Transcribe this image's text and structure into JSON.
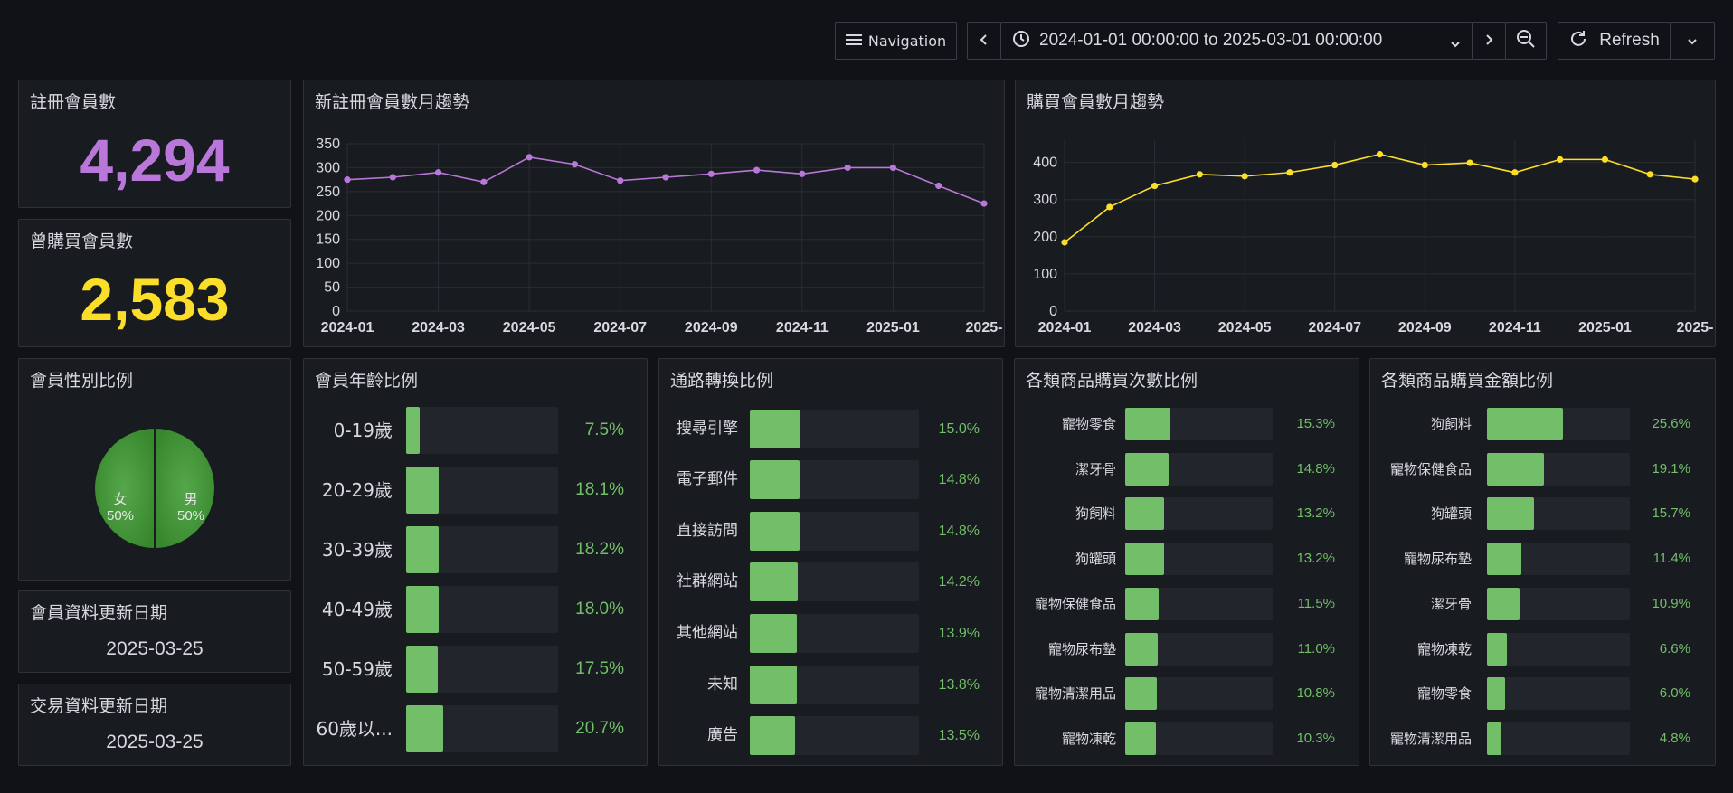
{
  "toolbar": {
    "navigation_label": "Navigation",
    "time_range": "2024-01-01 00:00:00 to 2025-03-01 00:00:00",
    "refresh_label": "Refresh"
  },
  "stats": {
    "registered_title": "註冊會員數",
    "registered_value": "4,294",
    "purchased_title": "曾購買會員數",
    "purchased_value": "2,583",
    "gender_title": "會員性別比例",
    "member_update_title": "會員資料更新日期",
    "member_update_value": "2025-03-25",
    "trade_update_title": "交易資料更新日期",
    "trade_update_value": "2025-03-25"
  },
  "gender": [
    {
      "label": "女",
      "pct": "50%",
      "value": 0.5
    },
    {
      "label": "男",
      "pct": "50%",
      "value": 0.5
    }
  ],
  "colors": {
    "purple": "#b877d9",
    "yellow": "#fade2a",
    "green": "#73bf69",
    "pie_green": "#37872d"
  },
  "chart_data": [
    {
      "type": "line",
      "title": "新註冊會員數月趨勢",
      "x": [
        "2024-01",
        "2024-02",
        "2024-03",
        "2024-04",
        "2024-05",
        "2024-06",
        "2024-07",
        "2024-08",
        "2024-09",
        "2024-10",
        "2024-11",
        "2024-12",
        "2025-01",
        "2025-02",
        "2025-03"
      ],
      "series": [
        {
          "values": [
            275,
            280,
            290,
            270,
            322,
            307,
            273,
            280,
            287,
            295,
            287,
            300,
            300,
            262,
            225
          ]
        }
      ],
      "xticks": [
        "2024-01",
        "2024-03",
        "2024-05",
        "2024-07",
        "2024-09",
        "2024-11",
        "2025-01",
        "2025-"
      ],
      "yticks": [
        0,
        50,
        100,
        150,
        200,
        250,
        300,
        350
      ],
      "ylim": [
        0,
        350
      ],
      "color": "#b877d9",
      "grid": true
    },
    {
      "type": "line",
      "title": "購買會員數月趨勢",
      "x": [
        "2024-01",
        "2024-02",
        "2024-03",
        "2024-04",
        "2024-05",
        "2024-06",
        "2024-07",
        "2024-08",
        "2024-09",
        "2024-10",
        "2024-11",
        "2024-12",
        "2025-01",
        "2025-02",
        "2025-03"
      ],
      "series": [
        {
          "values": [
            185,
            280,
            337,
            368,
            363,
            373,
            393,
            422,
            393,
            399,
            373,
            408,
            408,
            368,
            355
          ]
        }
      ],
      "xticks": [
        "2024-01",
        "2024-03",
        "2024-05",
        "2024-07",
        "2024-09",
        "2024-11",
        "2025-01",
        "2025-"
      ],
      "yticks": [
        0,
        100,
        200,
        300,
        400
      ],
      "ylim": [
        0,
        460
      ],
      "color": "#fade2a",
      "grid": true
    },
    {
      "type": "bar",
      "title": "會員年齡比例",
      "categories": [
        "0-19歲",
        "20-29歲",
        "30-39歲",
        "40-49歲",
        "50-59歲",
        "60歲以..."
      ],
      "values": [
        7.5,
        18.1,
        18.2,
        18.0,
        17.5,
        20.7
      ],
      "labels": [
        "7.5%",
        "18.1%",
        "18.2%",
        "18.0%",
        "17.5%",
        "20.7%"
      ]
    },
    {
      "type": "bar",
      "title": "通路轉換比例",
      "categories": [
        "搜尋引擎",
        "電子郵件",
        "直接訪問",
        "社群網站",
        "其他網站",
        "未知",
        "廣告"
      ],
      "values": [
        15.0,
        14.8,
        14.8,
        14.2,
        13.9,
        13.8,
        13.5
      ],
      "labels": [
        "15.0%",
        "14.8%",
        "14.8%",
        "14.2%",
        "13.9%",
        "13.8%",
        "13.5%"
      ]
    },
    {
      "type": "bar",
      "title": "各類商品購買次數比例",
      "categories": [
        "寵物零食",
        "潔牙骨",
        "狗飼料",
        "狗罐頭",
        "寵物保健食品",
        "寵物尿布墊",
        "寵物清潔用品",
        "寵物凍乾"
      ],
      "values": [
        15.3,
        14.8,
        13.2,
        13.2,
        11.5,
        11.0,
        10.8,
        10.3
      ],
      "labels": [
        "15.3%",
        "14.8%",
        "13.2%",
        "13.2%",
        "11.5%",
        "11.0%",
        "10.8%",
        "10.3%"
      ]
    },
    {
      "type": "bar",
      "title": "各類商品購買金額比例",
      "categories": [
        "狗飼料",
        "寵物保健食品",
        "狗罐頭",
        "寵物尿布墊",
        "潔牙骨",
        "寵物凍乾",
        "寵物零食",
        "寵物清潔用品"
      ],
      "values": [
        25.6,
        19.1,
        15.7,
        11.4,
        10.9,
        6.6,
        6.0,
        4.8
      ],
      "labels": [
        "25.6%",
        "19.1%",
        "15.7%",
        "11.4%",
        "10.9%",
        "6.6%",
        "6.0%",
        "4.8%"
      ]
    }
  ]
}
